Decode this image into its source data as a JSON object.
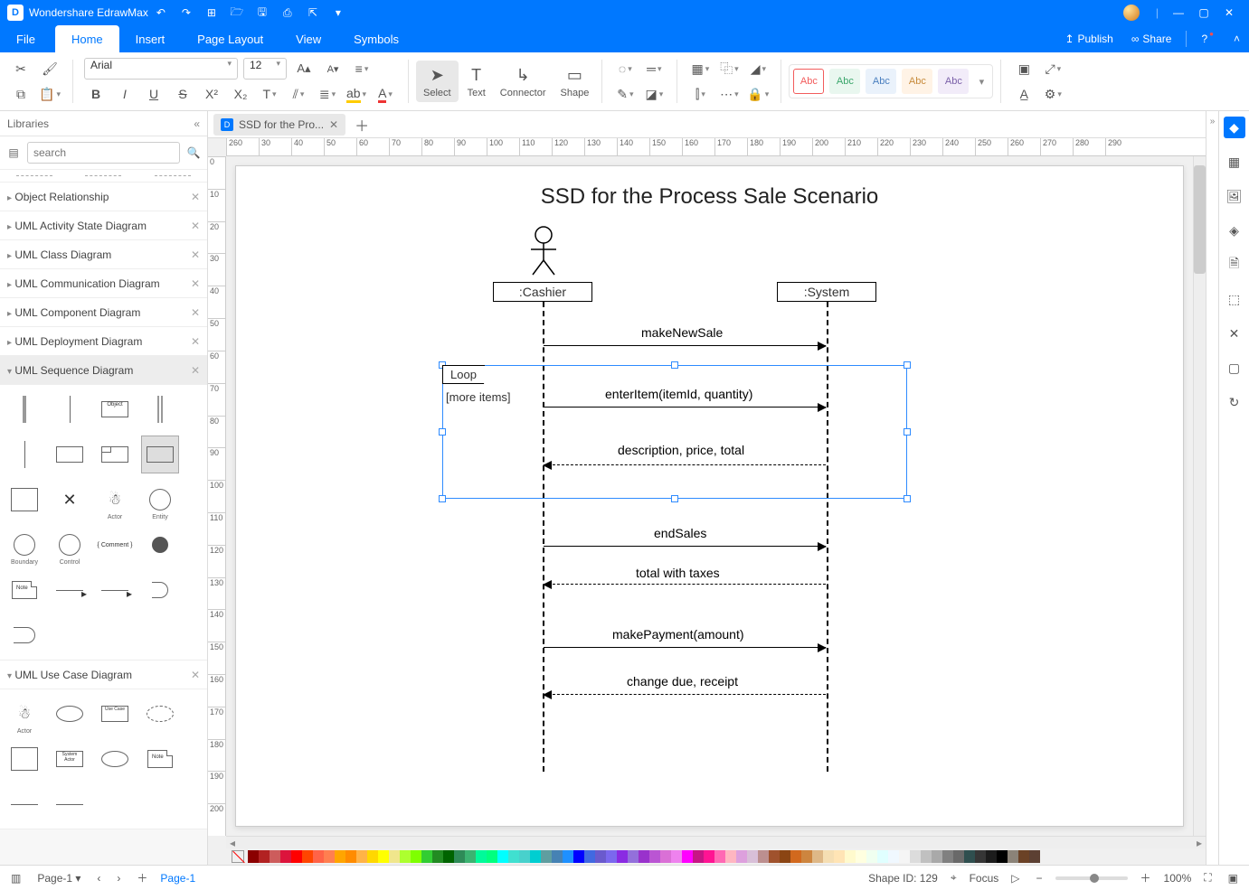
{
  "app_title": "Wondershare EdrawMax",
  "menus": {
    "file": "File",
    "home": "Home",
    "insert": "Insert",
    "page_layout": "Page Layout",
    "view": "View",
    "symbols": "Symbols"
  },
  "top_actions": {
    "publish": "Publish",
    "share": "Share"
  },
  "ribbon": {
    "font": "Arial",
    "size": "12",
    "tools": {
      "select": "Select",
      "text": "Text",
      "connector": "Connector",
      "shape": "Shape"
    },
    "styles": [
      "Abc",
      "Abc",
      "Abc",
      "Abc",
      "Abc"
    ]
  },
  "libraries": {
    "title": "Libraries",
    "search_placeholder": "search",
    "sections": [
      "Object Relationship",
      "UML Activity State Diagram",
      "UML Class Diagram",
      "UML Communication Diagram",
      "UML Component Diagram",
      "UML Deployment Diagram",
      "UML Sequence Diagram",
      "UML Use Case Diagram"
    ]
  },
  "doc_tab": "SSD for the Pro...",
  "ruler_h": [
    "260",
    "30",
    "40",
    "50",
    "60",
    "70",
    "80",
    "90",
    "100",
    "110",
    "120",
    "130",
    "140",
    "150",
    "160",
    "170",
    "180",
    "190",
    "200",
    "210",
    "220",
    "230",
    "240",
    "250",
    "260",
    "270",
    "280",
    "290"
  ],
  "ruler_v": [
    "0",
    "10",
    "20",
    "30",
    "40",
    "50",
    "60",
    "70",
    "80",
    "90",
    "100",
    "110",
    "120",
    "130",
    "140",
    "150",
    "160",
    "170",
    "180",
    "190",
    "200"
  ],
  "diagram": {
    "title": "SSD for the Process Sale Scenario",
    "actors": {
      "cashier": ":Cashier",
      "system": ":System"
    },
    "loop_label": "Loop",
    "loop_cond": "[more items]",
    "messages": {
      "m1": "makeNewSale",
      "m2": "enterItem(itemId, quantity)",
      "m3": "description, price, total",
      "m4": "endSales",
      "m5": "total with taxes",
      "m6": "makePayment(amount)",
      "m7": "change due, receipt"
    }
  },
  "status": {
    "page_select": "Page-1",
    "page_tab": "Page-1",
    "shape_id": "Shape ID: 129",
    "focus": "Focus",
    "zoom": "100%"
  },
  "colors": [
    "#8b0000",
    "#b22222",
    "#cd5c5c",
    "#dc143c",
    "#ff0000",
    "#ff4500",
    "#ff6347",
    "#ff7f50",
    "#ffa500",
    "#ff8c00",
    "#ffb347",
    "#ffd700",
    "#ffff00",
    "#f0e68c",
    "#adff2f",
    "#7fff00",
    "#32cd32",
    "#228b22",
    "#006400",
    "#2e8b57",
    "#3cb371",
    "#00fa9a",
    "#00ff7f",
    "#00ffff",
    "#40e0d0",
    "#48d1cc",
    "#00ced1",
    "#5f9ea0",
    "#4682b4",
    "#1e90ff",
    "#0000ff",
    "#4169e1",
    "#6a5acd",
    "#7b68ee",
    "#8a2be2",
    "#9370db",
    "#9932cc",
    "#ba55d3",
    "#da70d6",
    "#ee82ee",
    "#ff00ff",
    "#c71585",
    "#ff1493",
    "#ff69b4",
    "#ffb6c1",
    "#dda0dd",
    "#d8bfd8",
    "#bc8f8f",
    "#a0522d",
    "#8b4513",
    "#d2691e",
    "#cd853f",
    "#deb887",
    "#f5deb3",
    "#ffe4b5",
    "#fffacd",
    "#ffffe0",
    "#f0fff0",
    "#e0ffff",
    "#f0f8ff",
    "#f5f5f5",
    "#dcdcdc",
    "#c0c0c0",
    "#a9a9a9",
    "#808080",
    "#696969",
    "#2f4f4f",
    "#363636",
    "#1c1c1c",
    "#000000",
    "#8b8378",
    "#6b4226",
    "#5c4033"
  ]
}
